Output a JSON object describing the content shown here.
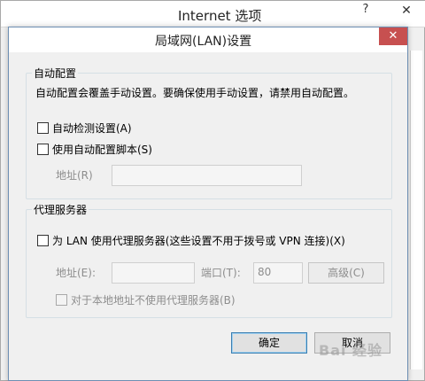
{
  "parent_window": {
    "title": "Internet 选项",
    "help_icon": "?",
    "close_icon": "✕"
  },
  "dialog": {
    "title": "局域网(LAN)设置",
    "close_icon": "✕",
    "auto_config": {
      "title": "自动配置",
      "description": "自动配置会覆盖手动设置。要确保使用手动设置，请禁用自动配置。",
      "auto_detect_label": "自动检测设置(A)",
      "auto_detect_checked": false,
      "use_script_label": "使用自动配置脚本(S)",
      "use_script_checked": false,
      "address_label": "地址(R)",
      "address_value": ""
    },
    "proxy": {
      "title": "代理服务器",
      "use_proxy_label": "为 LAN 使用代理服务器(这些设置不用于拨号或 VPN 连接)(X)",
      "use_proxy_checked": false,
      "address_label": "地址(E):",
      "address_value": "",
      "port_label": "端口(T):",
      "port_value": "80",
      "advanced_label": "高级(C)",
      "bypass_local_label": "对于本地地址不使用代理服务器(B)",
      "bypass_local_checked": false
    },
    "ok_label": "确定",
    "cancel_label": "取消"
  },
  "watermark": "Bai 经验"
}
